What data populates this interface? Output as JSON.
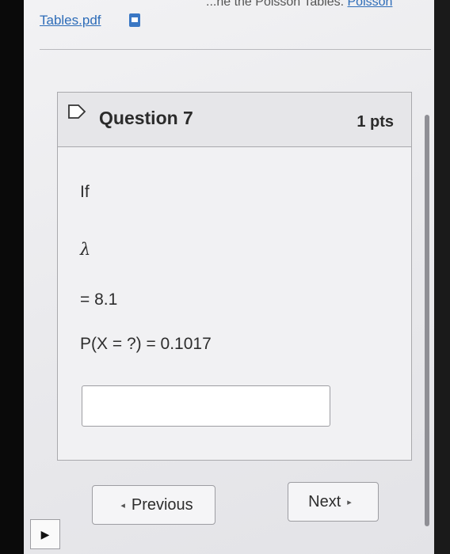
{
  "header": {
    "cut_text": "...ne the Poisson Tables.",
    "cut_link": "Poisson",
    "pdf_link": "Tables.pdf"
  },
  "question": {
    "title": "Question 7",
    "points": "1 pts",
    "line1": "If",
    "lambda": "λ",
    "line3": "= 8.1",
    "line4": "P(X = ?) = 0.1017",
    "answer_value": ""
  },
  "nav": {
    "previous": "Previous",
    "next": "Next",
    "prev_icon": "◂",
    "next_icon": "▸",
    "corner_icon": "▶"
  },
  "colors": {
    "link": "#2d6cb8",
    "frame": "#0a0a0a"
  }
}
